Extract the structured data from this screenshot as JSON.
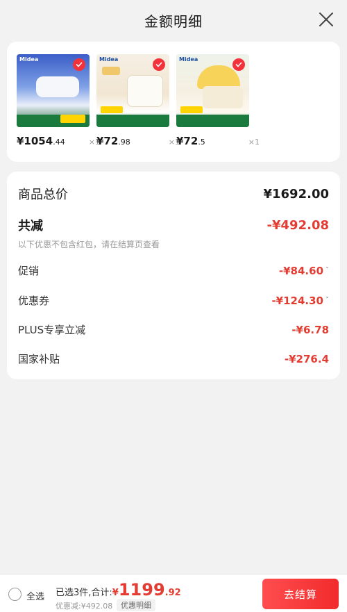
{
  "header": {
    "title": "金额明细"
  },
  "products": [
    {
      "brand": "Midea",
      "price_int": "¥1054",
      "price_dec": ".44",
      "qty": "×1"
    },
    {
      "brand": "Midea",
      "price_int": "¥72",
      "price_dec": ".98",
      "qty": "×1"
    },
    {
      "brand": "Midea",
      "price_int": "¥72",
      "price_dec": ".5",
      "qty": "×1"
    }
  ],
  "details": {
    "total_label": "商品总价",
    "total_value": "¥1692.00",
    "reduce_label": "共减",
    "reduce_value": "-¥492.08",
    "note": "以下优惠不包含红包，请在结算页查看",
    "rows": [
      {
        "label": "促销",
        "value": "-¥84.60",
        "has_chevron": true
      },
      {
        "label": "优惠券",
        "value": "-¥124.30",
        "has_chevron": true
      },
      {
        "label": "PLUS专享立减",
        "value": "-¥6.78",
        "has_chevron": false
      },
      {
        "label": "国家补贴",
        "value": "-¥276.4",
        "has_chevron": false
      }
    ],
    "chevron": "ˇ"
  },
  "bottom": {
    "select_all": "全选",
    "summary_prefix": "已选3件,合计:",
    "currency": "¥",
    "amount_int": "1199",
    "amount_dec": ".92",
    "discount": "优惠减:¥492.08",
    "detail_chip": "优惠明细",
    "checkout": "去结算"
  },
  "colors": {
    "accent": "#e33d33",
    "checkout": "#f22b2b"
  },
  "icons": {
    "close": "close-icon",
    "check": "check-icon"
  }
}
